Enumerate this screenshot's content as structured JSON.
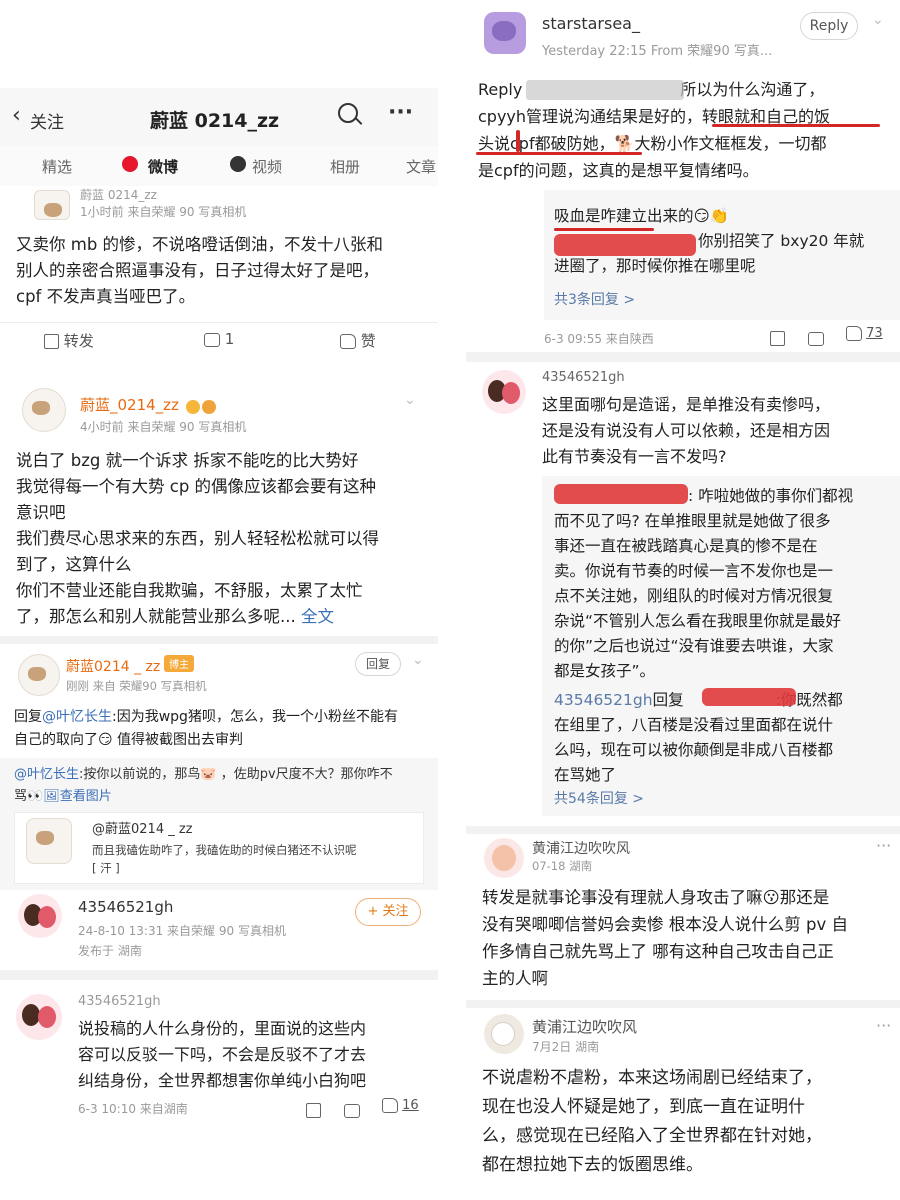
{
  "left": {
    "nav": {
      "back_label": "关注",
      "title": "蔚蓝 0214_zz",
      "more": "···"
    },
    "tabs": [
      "精选",
      "微博",
      "视频",
      "相册",
      "文章"
    ],
    "post1": {
      "name": "蔚蓝 0214_zz",
      "meta": "1小时前  来自荣耀 90 写真相机",
      "lines": [
        "又卖你 mb 的惨，不说咯噔话倒油，不发十八张和",
        "别人的亲密合照逼事没有，日子过得太好了是吧，",
        "cpf 不发声真当哑巴了。"
      ],
      "share": "转发",
      "comment": "1",
      "like": "赞"
    },
    "post2": {
      "name": "蔚蓝_0214_zz",
      "meta": "4小时前  来自荣耀 90 写真相机",
      "lines": [
        "说白了 bzg 就一个诉求 拆家不能吃的比大势好",
        "我觉得每一个有大势 cp 的偶像应该都会要有这种",
        "意识吧",
        "我们费尽心思求来的东西，别人轻轻松松就可以得",
        "到了，这算什么",
        "你们不营业还能自我欺骗，不舒服，太累了太忙",
        "了，那怎么和别人就能营业那么多呢..."
      ],
      "more_link": "全文"
    },
    "post3": {
      "name": "蔚蓝0214 _ zz",
      "badge": "博主",
      "meta": "刚刚  来自  荣耀90 写真相机",
      "reply_btn": "回复",
      "line1_prefix": "回复",
      "line1_mention": "@叶忆长生",
      "line1_rest": ":因为我wpg猪呗，怎么，我一个小粉丝不能有",
      "line2": "自己的取向了😏 值得被截图出去审判",
      "quoted_name": "@叶忆长生",
      "quoted_text": ":按你以前说的，那鸟🐷 ，佐助pv尺度不大？那你咋不",
      "quoted_text2": "骂👀",
      "view_image": "查看图片",
      "inner_name": "@蔚蓝0214 _ zz",
      "inner_text": "而且我磕佐助咋了，我磕佐助的时候白猪还不认识呢",
      "inner_text2": "[ 汗 ]"
    },
    "post4": {
      "name": "43546521gh",
      "meta": "24-8-10 13:31  来自荣耀 90 写真相机",
      "loc": "发布于 湖南",
      "follow": "+ 关注"
    },
    "post5": {
      "name": "43546521gh",
      "lines": [
        "说投稿的人什么身份的，里面说的这些内",
        "容可以反驳一下吗，不会是反驳不了才去",
        "纠结身份，全世界都想害你单纯小白狗吧"
      ],
      "meta": "6-3 10:10  来自湖南",
      "likes": "16"
    }
  },
  "right": {
    "c1": {
      "name": "starstarsea_",
      "meta": "Yesterday 22:15  From 荣耀90 写真...",
      "reply_btn": "Reply",
      "l1a": "Reply",
      "l1b": "所以为什么沟通了，",
      "l2": "cpyyh管理说沟通结果是好的，转眼就和自己的饭",
      "l3": "头说cpf都破防她，🐕大粉小作文框框发，一切都",
      "l4": "是cpf的问题，这真的是想平复情绪吗。"
    },
    "c2": {
      "l1": "吸血是咋建立出来的😏👏",
      "l2": "你别招笑了 bxy20 年就",
      "l3": "进圈了，那时候你推在哪里呢",
      "replies": "共3条回复 >",
      "meta": "6-3 09:55  来自陕西",
      "likes": "73"
    },
    "c3": {
      "name": "43546521gh",
      "lines": [
        "这里面哪句是造谣，是单推没有卖惨吗，",
        "还是没有说没有人可以依赖，还是相方因",
        "此有节奏没有一言不发吗?"
      ],
      "q1": ": 咋啦她做的事你们都视",
      "qlines": [
        "而不见了吗? 在单推眼里就是她做了很多",
        "事还一直在被践踏真心是真的惨不是在",
        "卖。你说有节奏的时候一言不发你也是一",
        "点不关注她，刚组队的时候对方情况很复",
        "杂说“不管别人怎么看在我眼里你就是最好",
        "的你”之后也说过“没有谁要去哄谁，大家",
        "都是女孩子”。"
      ],
      "r_name": "43546521gh",
      "r_mid": "回复",
      "r_rest": ":你既然都",
      "rlines": [
        "在组里了，八百楼是没看过里面都在说什",
        "么吗，现在可以被你颠倒是非成八百楼都",
        "在骂她了"
      ],
      "replies": "共54条回复 >"
    },
    "c4": {
      "name": "黄浦江边吹吹风",
      "meta": "07-18  湖南",
      "lines": [
        "转发是就事论事没有理就人身攻击了嘛😗那还是",
        "没有哭唧唧信誉妈会卖惨 根本没人说什么剪 pv 自",
        "作多情自己就先骂上了 哪有这种自己攻击自己正",
        "主的人啊"
      ]
    },
    "c5": {
      "name": "黄浦江边吹吹风",
      "meta": "7月2日  湖南",
      "lines": [
        "不说虐粉不虐粉，本来这场闹剧已经结束了，",
        "现在也没人怀疑是她了，到底一直在证明什",
        "么，感觉现在已经陷入了全世界都在针对她，",
        "都在想拉她下去的饭圈思维。"
      ]
    }
  },
  "colors": {
    "accent_orange": "#e86a10",
    "link_blue": "#3b6fb6",
    "redaction_red": "#e03a3a"
  }
}
